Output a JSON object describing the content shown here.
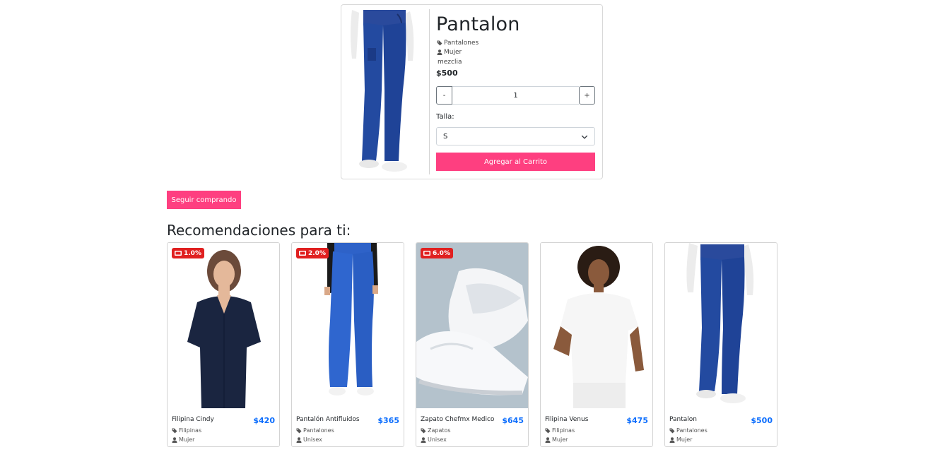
{
  "product": {
    "title": "Pantalon",
    "category": "Pantalones",
    "gender": "Mujer",
    "material": "mezclia",
    "price": "$500",
    "quantity": "1",
    "minus_label": "-",
    "plus_label": "+",
    "size_label": "Talla:",
    "size_value": "S",
    "add_to_cart": "Agregar al Carrito"
  },
  "continue_shopping": "Seguir comprando",
  "recommendations_title": "Recomendaciones para ti:",
  "recommendations": [
    {
      "name": "Filipina Cindy",
      "price": "$420",
      "category": "Filipinas",
      "gender": "Mujer",
      "discount": "1.0%"
    },
    {
      "name": "Pantalón Antifluidos",
      "price": "$365",
      "category": "Pantalones",
      "gender": "Unisex",
      "discount": "2.0%"
    },
    {
      "name": "Zapato Chefmx Medico",
      "price": "$645",
      "category": "Zapatos",
      "gender": "Unisex",
      "discount": "6.0%"
    },
    {
      "name": "Filipina Venus",
      "price": "$475",
      "category": "Filipinas",
      "gender": "Mujer",
      "discount": ""
    },
    {
      "name": "Pantalon",
      "price": "$500",
      "category": "Pantalones",
      "gender": "Mujer",
      "discount": ""
    }
  ],
  "colors": {
    "accent": "#fe3f80",
    "price_blue": "#0d6efd",
    "badge_red": "#e02020"
  }
}
